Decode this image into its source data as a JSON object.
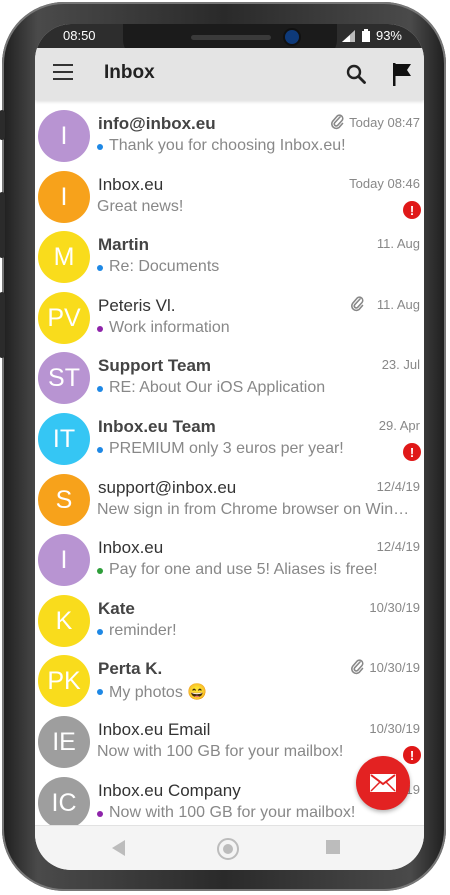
{
  "status_bar": {
    "time": "08:50",
    "battery": "93%"
  },
  "app_bar": {
    "title": "Inbox"
  },
  "messages": [
    {
      "initials": "I",
      "sender": "info@inbox.eu",
      "bold": true,
      "date": "Today 08:47",
      "preview": "Thank you for choosing Inbox.eu!",
      "unread_dot_color": "#1e88e5",
      "attachment": true,
      "important": false,
      "avatar_color": "#b894d2"
    },
    {
      "initials": "I",
      "sender": "Inbox.eu",
      "bold": false,
      "date": "Today 08:46",
      "preview": "Great news!",
      "unread_dot_color": "",
      "attachment": false,
      "important": true,
      "avatar_color": "#f7a21b"
    },
    {
      "initials": "M",
      "sender": "Martin",
      "bold": true,
      "date": "11. Aug",
      "preview": "Re: Documents",
      "unread_dot_color": "#1e88e5",
      "attachment": false,
      "important": false,
      "avatar_color": "#f9dc1c"
    },
    {
      "initials": "PV",
      "sender": "Peteris Vl.",
      "bold": false,
      "date": "11. Aug",
      "preview": "Work information",
      "unread_dot_color": "#8e24aa",
      "attachment": true,
      "important": false,
      "avatar_color": "#f9dc1c"
    },
    {
      "initials": "ST",
      "sender": "Support Team",
      "bold": true,
      "date": "23. Jul",
      "preview": "RE: About Our iOS Application",
      "unread_dot_color": "#1e88e5",
      "attachment": false,
      "important": false,
      "avatar_color": "#b894d2"
    },
    {
      "initials": "IT",
      "sender": "Inbox.eu Team",
      "bold": true,
      "date": "29. Apr",
      "preview": "PREMIUM only 3 euros per year!",
      "unread_dot_color": "#1e88e5",
      "attachment": false,
      "important": true,
      "avatar_color": "#35c6f4"
    },
    {
      "initials": "S",
      "sender": "support@inbox.eu",
      "bold": false,
      "date": "12/4/19",
      "preview": "New sign in from Chrome browser on Wind...",
      "unread_dot_color": "",
      "attachment": false,
      "important": false,
      "avatar_color": "#f7a21b"
    },
    {
      "initials": "I",
      "sender": "Inbox.eu",
      "bold": false,
      "date": "12/4/19",
      "preview": "Pay for one and use 5! Aliases is free!",
      "unread_dot_color": "#2e9e3a",
      "attachment": false,
      "important": false,
      "avatar_color": "#b894d2"
    },
    {
      "initials": "K",
      "sender": "Kate",
      "bold": true,
      "date": "10/30/19",
      "preview": "reminder!",
      "unread_dot_color": "#1e88e5",
      "attachment": false,
      "important": false,
      "avatar_color": "#f9dc1c"
    },
    {
      "initials": "PK",
      "sender": "Perta K.",
      "bold": true,
      "date": "10/30/19",
      "preview": "My photos 😄",
      "unread_dot_color": "#1e88e5",
      "attachment": true,
      "important": false,
      "avatar_color": "#f9dc1c"
    },
    {
      "initials": "IE",
      "sender": "Inbox.eu Email",
      "bold": false,
      "date": "10/30/19",
      "preview": "Now with 100 GB for your mailbox!",
      "unread_dot_color": "",
      "attachment": false,
      "important": true,
      "avatar_color": "#9e9e9e"
    },
    {
      "initials": "IC",
      "sender": "Inbox.eu Company",
      "bold": false,
      "date": "10/30/19",
      "preview": "Now with 100 GB for your mailbox!",
      "unread_dot_color": "#8e24aa",
      "attachment": false,
      "important": false,
      "avatar_color": "#9e9e9e"
    }
  ]
}
